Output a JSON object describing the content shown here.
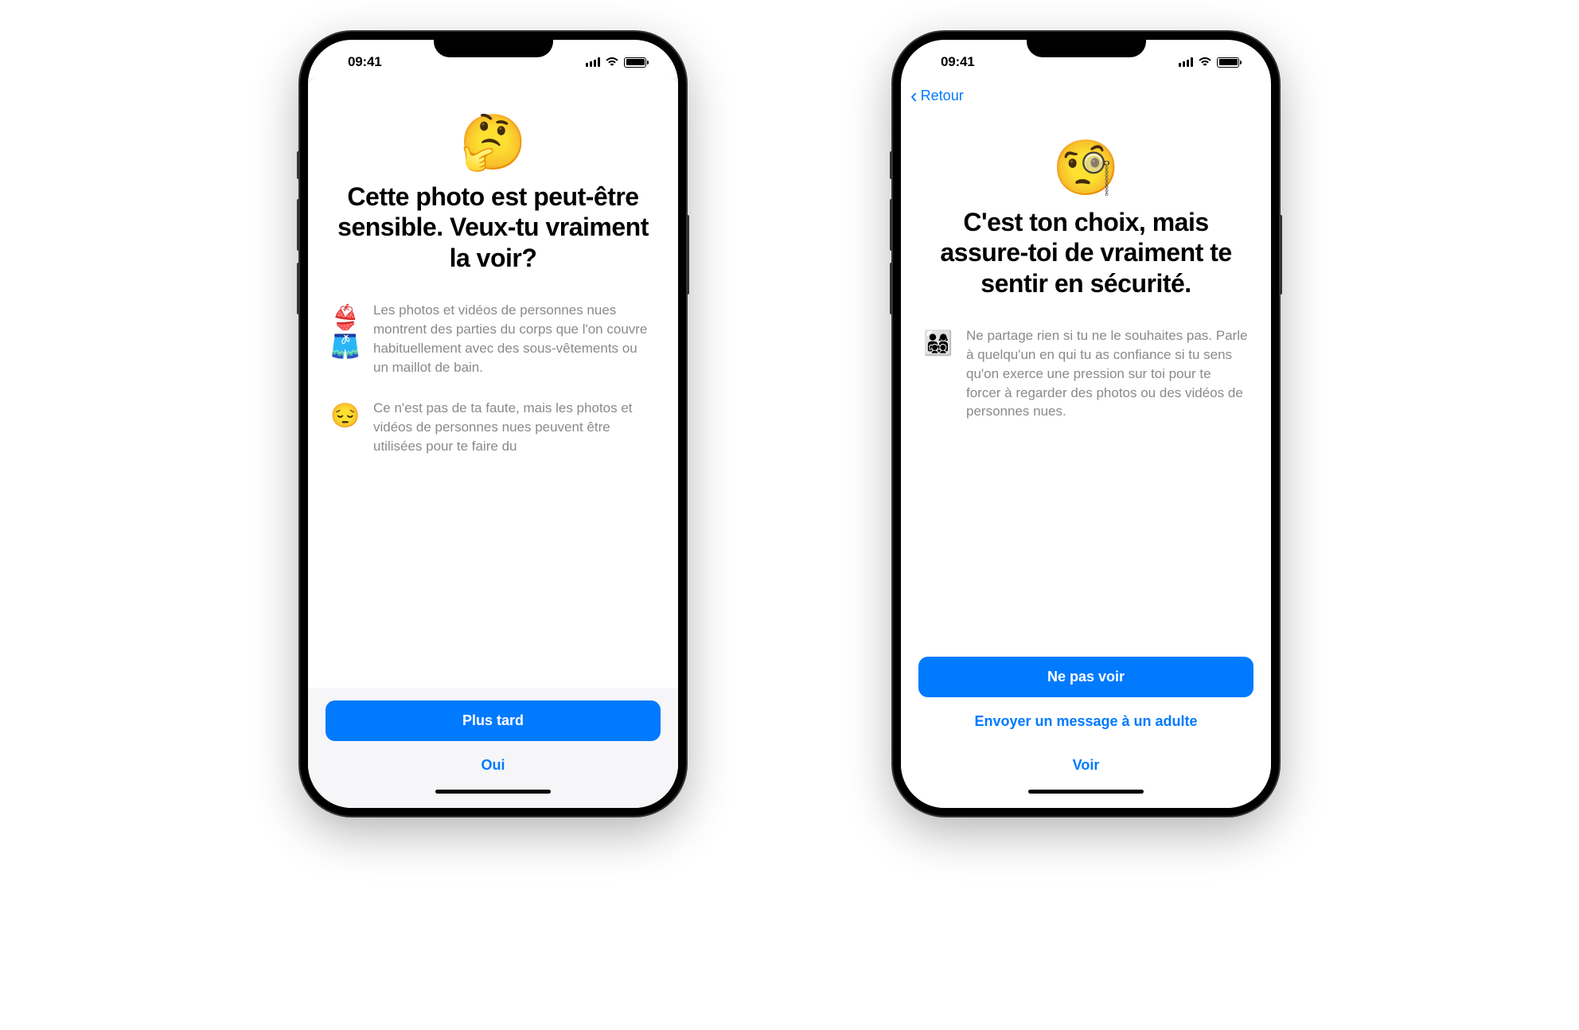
{
  "status": {
    "time": "09:41"
  },
  "nav": {
    "back_label": "Retour"
  },
  "phone1": {
    "emoji": "🤔",
    "title": "Cette photo est peut-être sensible. Veux-tu vraiment la voir?",
    "items": [
      {
        "icon": "👙🩳",
        "text": "Les photos et vidéos de personnes nues montrent des parties du corps que l'on couvre habituellement avec des sous-vêtements ou un maillot de bain."
      },
      {
        "icon": "😔",
        "text": "Ce n'est pas de ta faute, mais les photos et vidéos de personnes nues peuvent être utilisées pour te faire du"
      }
    ],
    "primary_button": "Plus tard",
    "secondary_button": "Oui"
  },
  "phone2": {
    "emoji": "🧐",
    "title": "C'est ton choix, mais assure-toi de vraiment te sentir en sécurité.",
    "items": [
      {
        "icon": "👨‍👩‍👧‍👦",
        "text": "Ne partage rien si tu ne le souhaites pas. Parle à quelqu'un en qui tu as confiance si tu sens qu'on exerce une pression sur toi pour te forcer à regarder des photos ou des vidéos de personnes nues."
      }
    ],
    "primary_button": "Ne pas voir",
    "secondary_button_1": "Envoyer un message à un adulte",
    "secondary_button_2": "Voir"
  }
}
